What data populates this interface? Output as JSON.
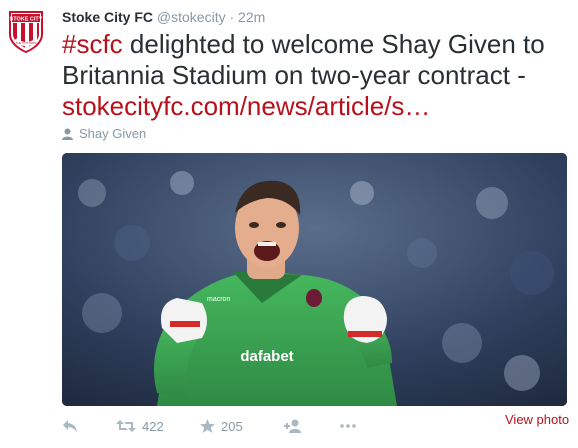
{
  "tweet": {
    "author_name": "Stoke City FC",
    "handle": "@stokecity",
    "separator": "·",
    "time": "22m",
    "hashtag": "#scfc",
    "text_body": " delighted to welcome Shay Given to Britannia Stadium on two-year contract - ",
    "link": "stokecityfc.com/news/article/s…",
    "tagged_user": "Shay Given",
    "view_photo": "View photo",
    "retweet_count": "422",
    "favorite_count": "205",
    "avatar_label": "STOKE CITY",
    "avatar_label_bottom": "THE POTTERS"
  },
  "photo": {
    "shirt_sponsor": "dafabet",
    "glove_brand": "macron"
  },
  "colors": {
    "accent": "#b8111b",
    "muted": "#8899a6",
    "text": "#292f33",
    "keeper_shirt": "#3daa55"
  },
  "icons": [
    "crest-icon",
    "person-icon",
    "reply-icon",
    "retweet-icon",
    "favorite-icon",
    "follow-icon",
    "more-icon"
  ]
}
